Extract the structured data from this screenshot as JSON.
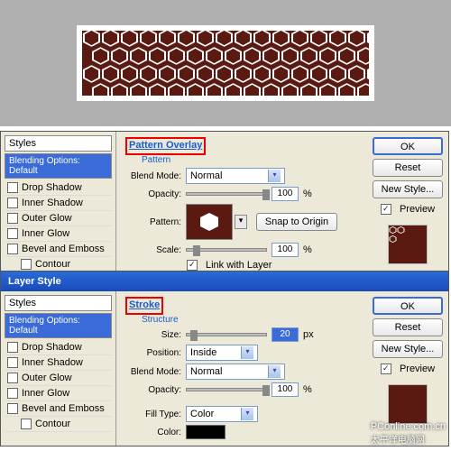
{
  "preview": {
    "pattern_name": "honeycomb"
  },
  "dialog1": {
    "styles_header": "Styles",
    "blending_options": "Blending Options: Default",
    "items": [
      "Drop Shadow",
      "Inner Shadow",
      "Outer Glow",
      "Inner Glow",
      "Bevel and Emboss",
      "Contour"
    ],
    "section": "Pattern Overlay",
    "subsection": "Pattern",
    "blend_mode_label": "Blend Mode:",
    "blend_mode_value": "Normal",
    "opacity_label": "Opacity:",
    "opacity_value": "100",
    "opacity_unit": "%",
    "pattern_label": "Pattern:",
    "snap_button": "Snap to Origin",
    "scale_label": "Scale:",
    "scale_value": "100",
    "scale_unit": "%",
    "link_label": "Link with Layer",
    "buttons": {
      "ok": "OK",
      "reset": "Reset",
      "new_style": "New Style...",
      "preview": "Preview"
    }
  },
  "dialog2": {
    "title": "Layer Style",
    "styles_header": "Styles",
    "blending_options": "Blending Options: Default",
    "items": [
      "Drop Shadow",
      "Inner Shadow",
      "Outer Glow",
      "Inner Glow",
      "Bevel and Emboss",
      "Contour"
    ],
    "section": "Stroke",
    "subsection": "Structure",
    "size_label": "Size:",
    "size_value": "20",
    "size_unit": "px",
    "position_label": "Position:",
    "position_value": "Inside",
    "blend_mode_label": "Blend Mode:",
    "blend_mode_value": "Normal",
    "opacity_label": "Opacity:",
    "opacity_value": "100",
    "opacity_unit": "%",
    "fill_type_label": "Fill Type:",
    "fill_type_value": "Color",
    "color_label": "Color:",
    "buttons": {
      "ok": "OK",
      "reset": "Reset",
      "new_style": "New Style...",
      "preview": "Preview"
    }
  },
  "watermark": {
    "line1": "PConline.com.cn",
    "line2": "太平洋电脑网"
  }
}
